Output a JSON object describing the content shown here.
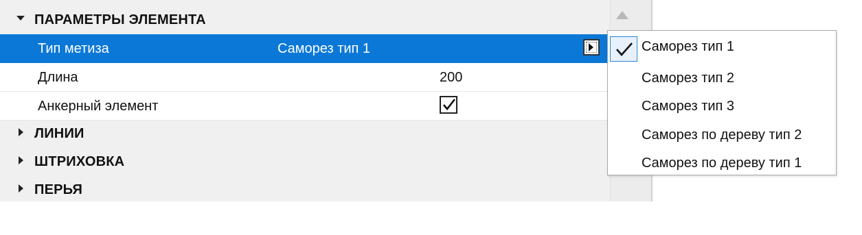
{
  "sections": {
    "element_params": "ПАРАМЕТРЫ ЭЛЕМЕНТА",
    "lines": "ЛИНИИ",
    "hatching": "ШТРИХОВКА",
    "pens": "ПЕРЬЯ"
  },
  "properties": [
    {
      "name": "Тип метиза",
      "value": "Саморез тип 1"
    },
    {
      "name": "Длина",
      "value": "200"
    },
    {
      "name": "Анкерный элемент",
      "checked": true
    }
  ],
  "menu": {
    "items": [
      {
        "label": "Саморез тип 1",
        "checked": true
      },
      {
        "label": "Саморез тип 2",
        "checked": false
      },
      {
        "label": "Саморез тип 3",
        "checked": false
      },
      {
        "label": "Саморез по дереву тип 2",
        "checked": false
      },
      {
        "label": "Саморез по дереву тип 1",
        "checked": false
      }
    ]
  },
  "colors": {
    "selection": "#0b78d7",
    "panel_bg": "#f0f0f0"
  }
}
